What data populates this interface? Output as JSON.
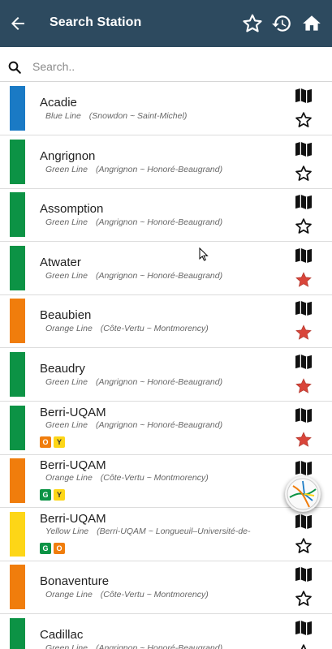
{
  "appbar": {
    "title": "Search Station",
    "background": "#2d4a5f",
    "icons": [
      "back-arrow-icon",
      "star-outline-icon",
      "history-icon",
      "home-icon"
    ]
  },
  "search": {
    "placeholder": "Search..",
    "value": "",
    "icon": "search-icon"
  },
  "lines": {
    "blue": "#1a7ac5",
    "green": "#0c9345",
    "orange": "#f07d0c",
    "yellow": "#fdd617"
  },
  "stations": [
    {
      "name": "Acadie",
      "line": "Blue Line",
      "range": "(Snowdon ~ Saint-Michel)",
      "color": "blue",
      "favorite": false,
      "transfers": []
    },
    {
      "name": "Angrignon",
      "line": "Green Line",
      "range": "(Angrignon ~ Honoré-Beaugrand)",
      "color": "green",
      "favorite": false,
      "transfers": []
    },
    {
      "name": "Assomption",
      "line": "Green Line",
      "range": "(Angrignon ~ Honoré-Beaugrand)",
      "color": "green",
      "favorite": false,
      "transfers": []
    },
    {
      "name": "Atwater",
      "line": "Green Line",
      "range": "(Angrignon ~ Honoré-Beaugrand)",
      "color": "green",
      "favorite": true,
      "transfers": []
    },
    {
      "name": "Beaubien",
      "line": "Orange Line",
      "range": "(Côte-Vertu ~ Montmorency)",
      "color": "orange",
      "favorite": true,
      "transfers": []
    },
    {
      "name": "Beaudry",
      "line": "Green Line",
      "range": "(Angrignon ~ Honoré-Beaugrand)",
      "color": "green",
      "favorite": true,
      "transfers": []
    },
    {
      "name": "Berri-UQAM",
      "line": "Green Line",
      "range": "(Angrignon ~ Honoré-Beaugrand)",
      "color": "green",
      "favorite": true,
      "transfers": [
        {
          "label": "O",
          "color": "orange"
        },
        {
          "label": "Y",
          "color": "yellow"
        }
      ]
    },
    {
      "name": "Berri-UQAM",
      "line": "Orange Line",
      "range": "(Côte-Vertu ~ Montmorency)",
      "color": "orange",
      "favorite": false,
      "transfers": [
        {
          "label": "G",
          "color": "green"
        },
        {
          "label": "Y",
          "color": "yellow"
        }
      ]
    },
    {
      "name": "Berri-UQAM",
      "line": "Yellow Line",
      "range": "(Berri-UQAM ~ Longueuil–Université-de-",
      "color": "yellow",
      "favorite": false,
      "transfers": [
        {
          "label": "G",
          "color": "green"
        },
        {
          "label": "O",
          "color": "orange"
        }
      ]
    },
    {
      "name": "Bonaventure",
      "line": "Orange Line",
      "range": "(Côte-Vertu ~ Montmorency)",
      "color": "orange",
      "favorite": false,
      "transfers": []
    },
    {
      "name": "Cadillac",
      "line": "Green Line",
      "range": "(Angrignon ~ Honoré-Beaugrand)",
      "color": "green",
      "favorite": false,
      "transfers": []
    }
  ],
  "star_fill": "#d9453a"
}
